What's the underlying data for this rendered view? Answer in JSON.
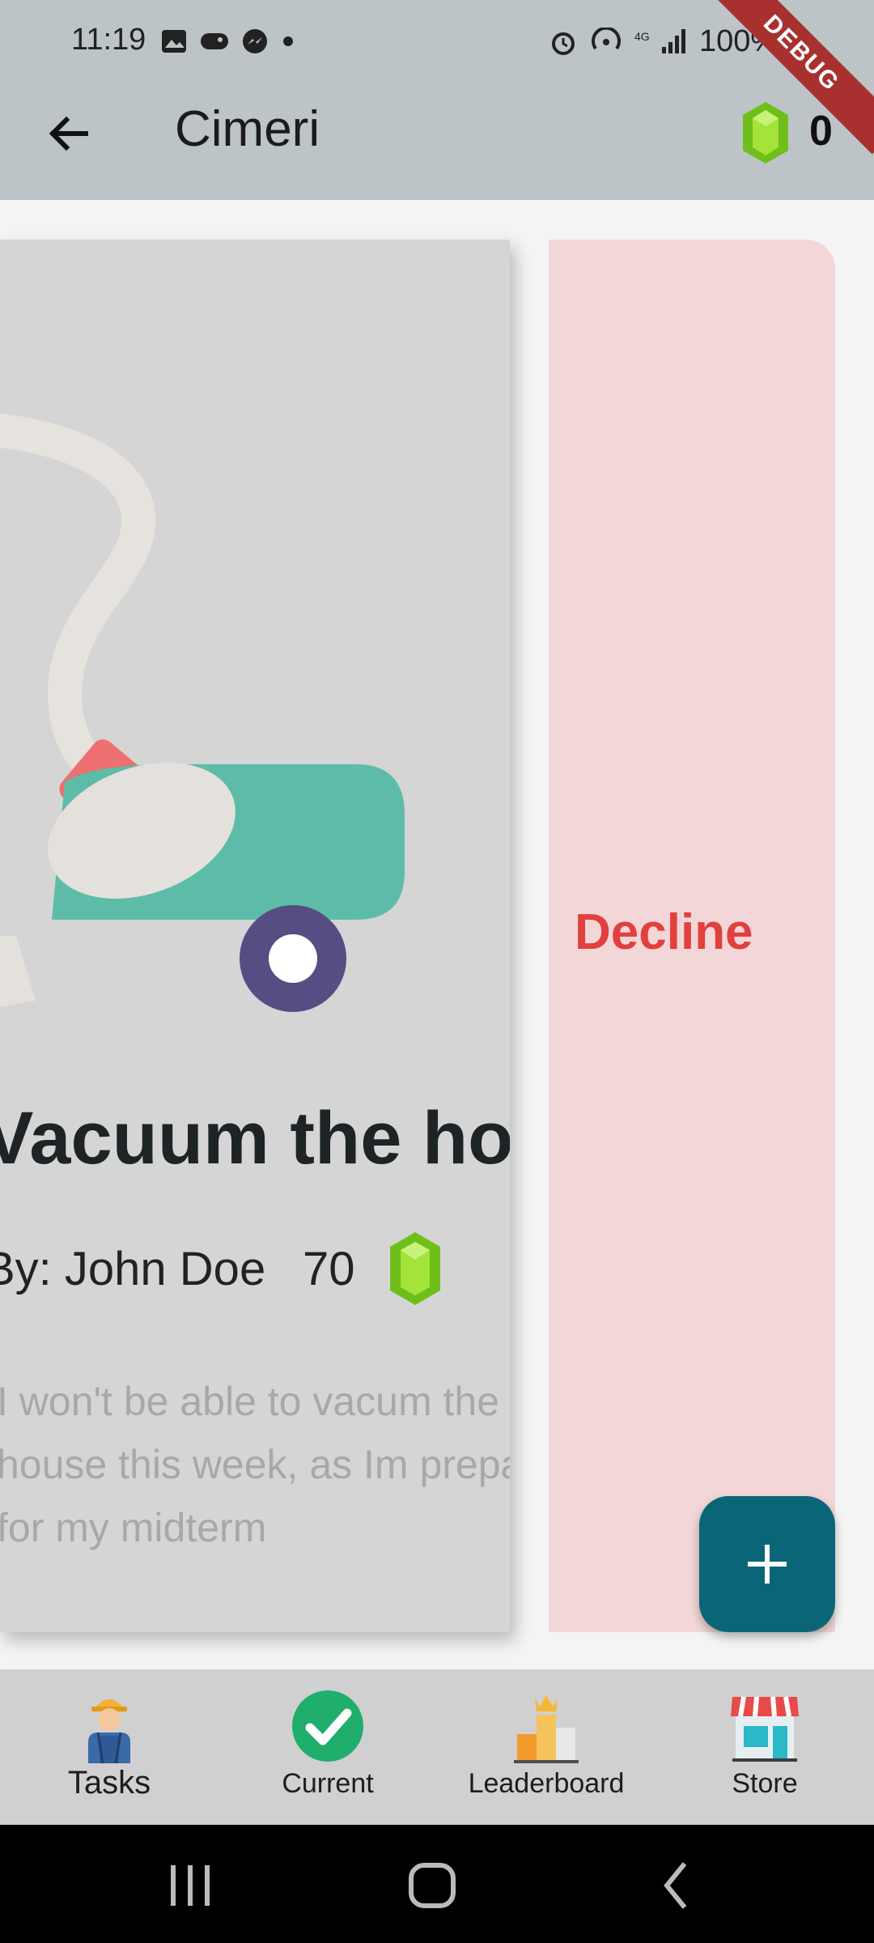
{
  "status_bar": {
    "time": "11:19",
    "battery": "100%",
    "debug_label": "DEBUG"
  },
  "app_bar": {
    "title": "Cimeri",
    "gem_count": "0"
  },
  "task": {
    "title": "Vacuum the house",
    "assigned_by": "By: John Doe",
    "points": "70",
    "description_lines": [
      "I won't be able to vacum the",
      "house this week, as Im preparing",
      "for my midterm"
    ]
  },
  "decline": {
    "label": "Decline"
  },
  "fab": {
    "icon": "plus-icon"
  },
  "bottom_nav": {
    "items": [
      {
        "label": "Tasks",
        "icon": "worker-icon"
      },
      {
        "label": "Current",
        "icon": "check-circle-icon"
      },
      {
        "label": "Leaderboard",
        "icon": "podium-icon"
      },
      {
        "label": "Store",
        "icon": "store-icon"
      }
    ],
    "active": "Tasks"
  },
  "colors": {
    "appbar": "#bdc4c7",
    "card": "#d5d5d5",
    "decline_bg": "#f3d7d8",
    "decline_text": "#e2403f",
    "fab": "#0a6677",
    "gem": "#7fcf1f"
  }
}
